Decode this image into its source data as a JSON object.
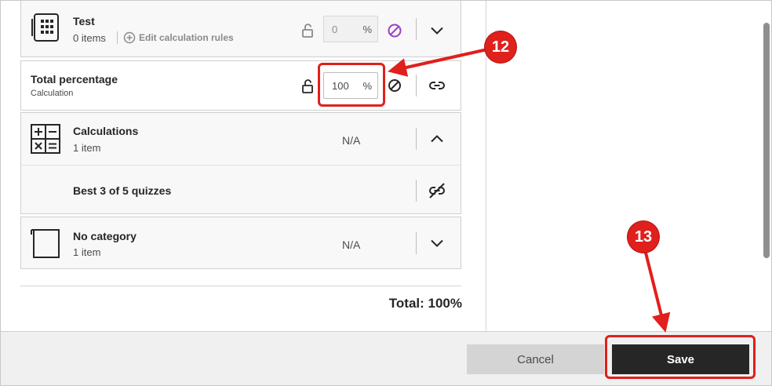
{
  "categories": {
    "test": {
      "title": "Test",
      "count": "0 items",
      "edit_rules_label": "Edit calculation rules",
      "percentage": "0",
      "percent_symbol": "%"
    },
    "total_percentage": {
      "title": "Total percentage",
      "subtitle": "Calculation",
      "percentage": "100",
      "percent_symbol": "%"
    },
    "calculations": {
      "title": "Calculations",
      "count": "1 item",
      "value": "N/A",
      "items": [
        {
          "title": "Best 3 of 5 quizzes"
        }
      ]
    },
    "no_category": {
      "title": "No category",
      "count": "1 item",
      "value": "N/A"
    }
  },
  "total_label": "Total: 100%",
  "footer": {
    "cancel_label": "Cancel",
    "save_label": "Save"
  },
  "annotations": {
    "step_12": "12",
    "step_13": "13"
  },
  "colors": {
    "annotation_red": "#e0201c",
    "save_button": "#262626",
    "cancel_button": "#d4d4d4",
    "exclude_icon_purple": "#9b3fc9"
  }
}
